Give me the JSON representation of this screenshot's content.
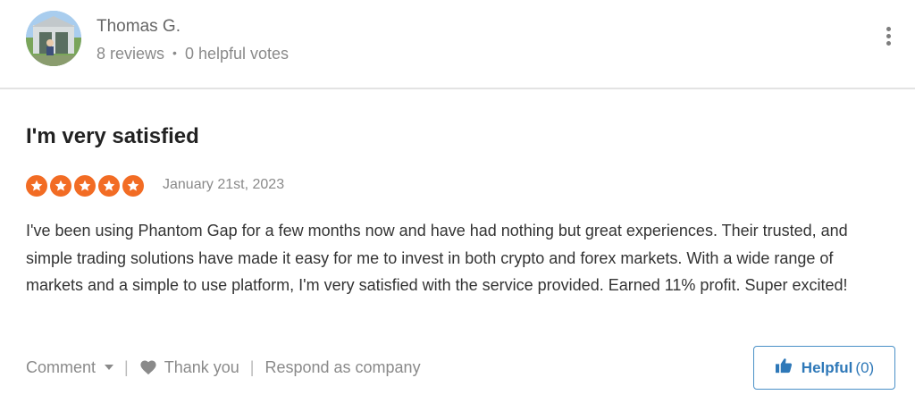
{
  "reviewer": {
    "name": "Thomas G.",
    "reviews": "8 reviews",
    "separator": "•",
    "helpful_votes": "0 helpful votes"
  },
  "review": {
    "title": "I'm very satisfied",
    "rating": 5,
    "rating_max": 5,
    "date": "January 21st, 2023",
    "text": "I've been using Phantom Gap for a few months now and have had nothing but great experiences. Their trusted, and simple trading solutions have made it easy for me to invest in both crypto and forex markets. With a wide range of markets and a simple to use platform, I'm very satisfied with the service provided. Earned 11% profit. Super excited!"
  },
  "actions": {
    "comment_label": "Comment",
    "thank_label": "Thank you",
    "respond_label": "Respond as company",
    "divider": "|"
  },
  "helpful": {
    "label": "Helpful",
    "count": "(0)"
  },
  "colors": {
    "star": "#f26c24",
    "accent": "#2e78b8",
    "divider": "#e3e3e3"
  },
  "icons": {
    "avatar": "avatar-photo",
    "more": "more-vertical-icon",
    "star": "star-icon",
    "chevron": "chevron-down-icon",
    "heart": "heart-icon",
    "thumbs_up": "thumbs-up-icon"
  }
}
